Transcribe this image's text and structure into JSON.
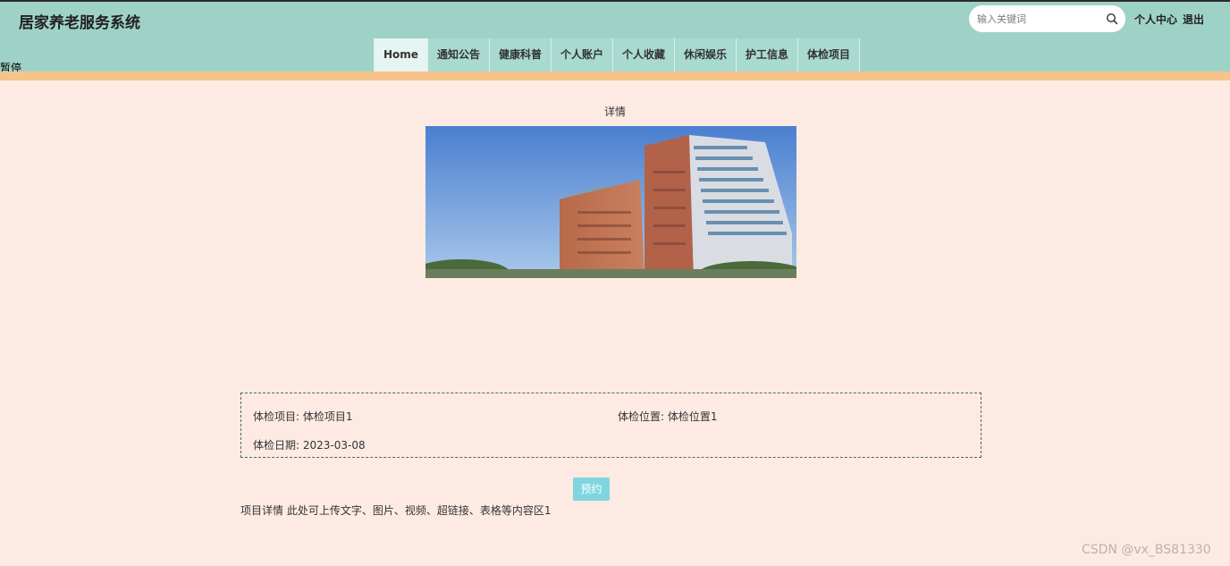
{
  "header": {
    "title": "居家养老服务系统",
    "search_placeholder": "输入关键词",
    "profile_link": "个人中心",
    "logout_link": "退出"
  },
  "nav": {
    "items": [
      {
        "label": "Home"
      },
      {
        "label": "通知公告"
      },
      {
        "label": "健康科普"
      },
      {
        "label": "个人账户"
      },
      {
        "label": "个人收藏"
      },
      {
        "label": "休闲娱乐"
      },
      {
        "label": "护工信息"
      },
      {
        "label": "体检项目"
      }
    ]
  },
  "stray_label": "暂停",
  "detail": {
    "title": "详情",
    "fields": {
      "item_label": "体检项目:",
      "item_value": "体检项目1",
      "location_label": "体检位置:",
      "location_value": "体检位置1",
      "date_label": "体检日期:",
      "date_value": "2023-03-08"
    },
    "book_button": "预约",
    "desc_label": "项目详情",
    "desc_value": "此处可上传文字、图片、视频、超链接、表格等内容区1"
  },
  "watermark": "CSDN @vx_BS81330",
  "colors": {
    "header_bg": "#9fd2c7",
    "page_bg": "#fdebe3",
    "accent_bar": "#f6c48a",
    "button": "#7fd6df"
  }
}
